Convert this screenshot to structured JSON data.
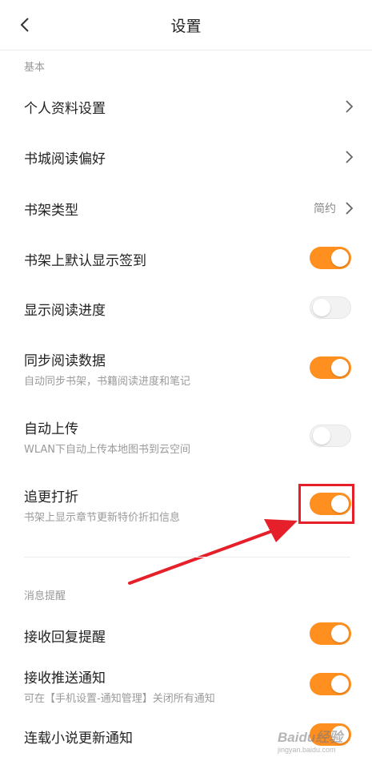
{
  "header": {
    "title": "设置"
  },
  "section_basic": {
    "label": "基本"
  },
  "rows": {
    "profile": {
      "title": "个人资料设置"
    },
    "store_pref": {
      "title": "书城阅读偏好"
    },
    "shelf_type": {
      "title": "书架类型",
      "value": "简约"
    },
    "default_checkin": {
      "title": "书架上默认显示签到",
      "toggle": true
    },
    "show_progress": {
      "title": "显示阅读进度",
      "toggle": false
    },
    "sync_data": {
      "title": "同步阅读数据",
      "subtitle": "自动同步书架，书籍阅读进度和笔记",
      "toggle": true
    },
    "auto_upload": {
      "title": "自动上传",
      "subtitle": "WLAN下自动上传本地图书到云空间",
      "toggle": false
    },
    "discount_follow": {
      "title": "追更打折",
      "subtitle": "书架上显示章节更新特价折扣信息",
      "toggle": true
    }
  },
  "section_notify": {
    "label": "消息提醒"
  },
  "notify_rows": {
    "reply": {
      "title": "接收回复提醒",
      "toggle": true
    },
    "push": {
      "title": "接收推送通知",
      "subtitle": "可在【手机设置-通知管理】关闭所有通知",
      "toggle": true
    },
    "serial": {
      "title": "连载小说更新通知",
      "toggle": true
    }
  },
  "watermark": {
    "text": "Baidu经验",
    "sub": "jingyan.baidu.com"
  },
  "colors": {
    "accent": "#ff8f1f",
    "annotation": "#e5202a"
  }
}
